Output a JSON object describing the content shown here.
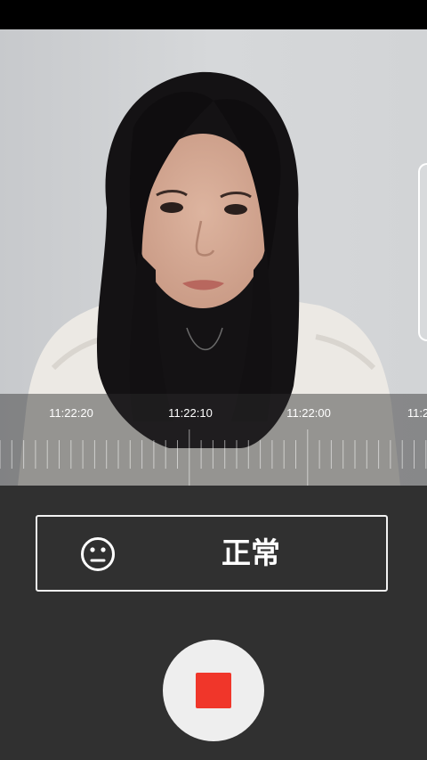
{
  "timeline": {
    "labels": [
      "11:22:20",
      "11:22:10",
      "11:22:00",
      "11:2"
    ]
  },
  "mood": {
    "label": "正常",
    "icon": "neutral-face-icon"
  },
  "record": {
    "icon": "stop-icon",
    "accent": "#f0362a"
  },
  "colors": {
    "panel_bg": "#303030",
    "status_bar": "#000000"
  }
}
